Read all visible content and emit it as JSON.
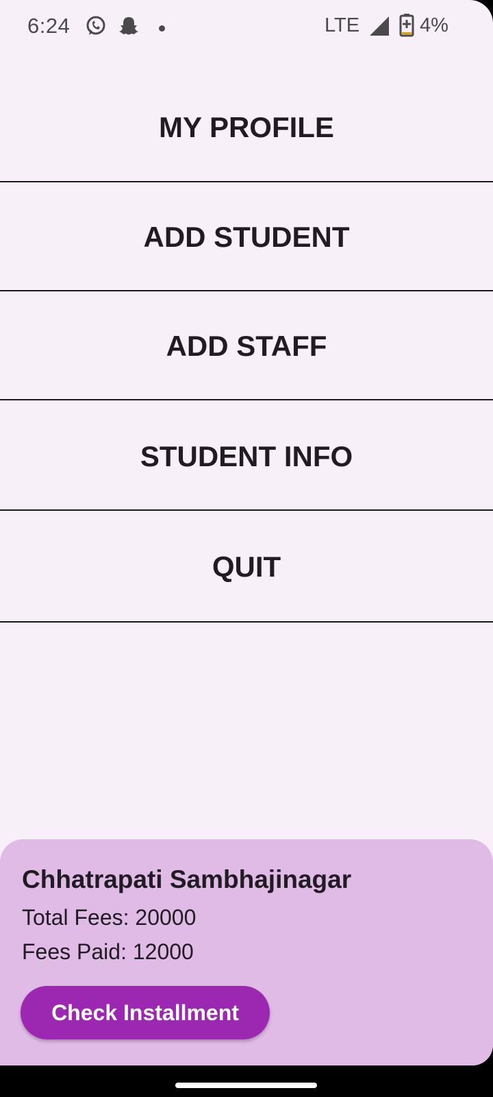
{
  "status_bar": {
    "time": "6:24",
    "network": "LTE",
    "battery": "4%",
    "icons": [
      "whatsapp-icon",
      "snapchat-icon",
      "notification-dot-icon",
      "signal-icon",
      "battery-charging-icon"
    ]
  },
  "menu": {
    "items": [
      {
        "label": "MY PROFILE"
      },
      {
        "label": "ADD STUDENT"
      },
      {
        "label": "ADD STAFF"
      },
      {
        "label": "STUDENT INFO"
      },
      {
        "label": "QUIT"
      }
    ]
  },
  "card": {
    "title": "Chhatrapati Sambhajinagar",
    "total_fees": "Total Fees: 20000",
    "fees_paid": "Fees Paid: 12000",
    "button_label": "Check Installment"
  },
  "colors": {
    "background": "#f7f0f9",
    "card": "#e0bbe6",
    "accent": "#9c27b0",
    "text": "#211c24"
  }
}
